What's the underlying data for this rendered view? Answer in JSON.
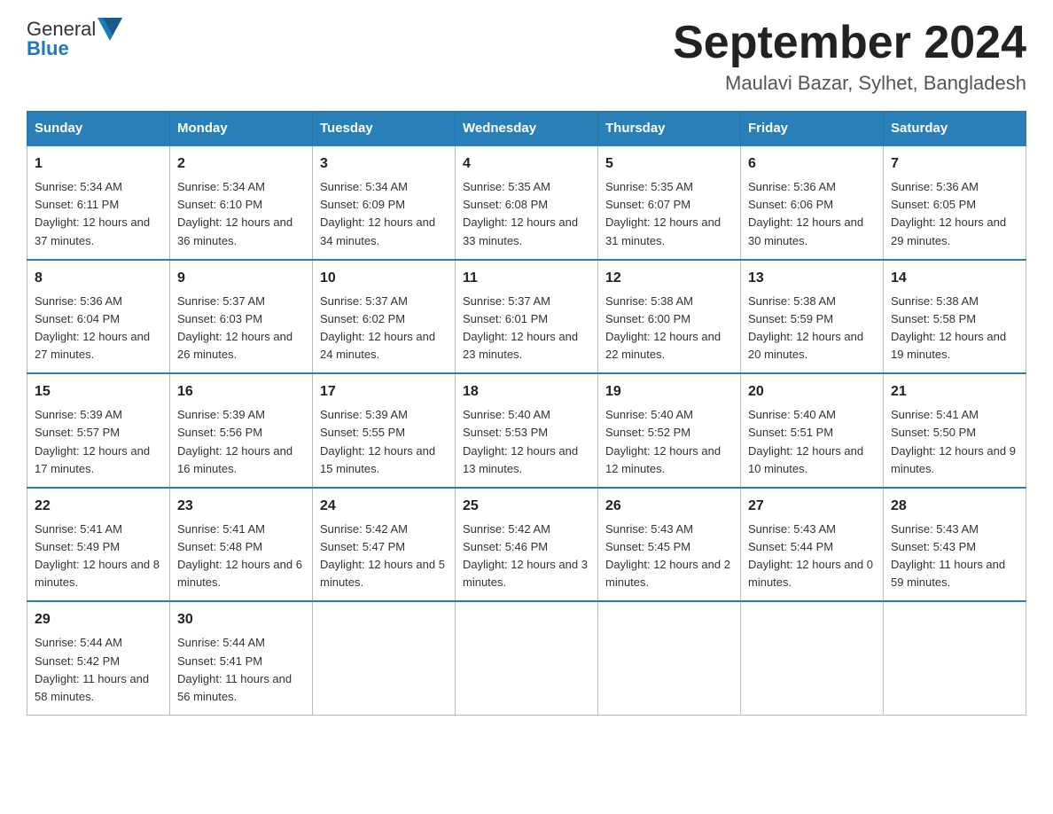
{
  "header": {
    "logo_general": "General",
    "logo_blue": "Blue",
    "month_title": "September 2024",
    "subtitle": "Maulavi Bazar, Sylhet, Bangladesh"
  },
  "days_of_week": [
    "Sunday",
    "Monday",
    "Tuesday",
    "Wednesday",
    "Thursday",
    "Friday",
    "Saturday"
  ],
  "weeks": [
    [
      {
        "day": "1",
        "sunrise": "5:34 AM",
        "sunset": "6:11 PM",
        "daylight": "12 hours and 37 minutes."
      },
      {
        "day": "2",
        "sunrise": "5:34 AM",
        "sunset": "6:10 PM",
        "daylight": "12 hours and 36 minutes."
      },
      {
        "day": "3",
        "sunrise": "5:34 AM",
        "sunset": "6:09 PM",
        "daylight": "12 hours and 34 minutes."
      },
      {
        "day": "4",
        "sunrise": "5:35 AM",
        "sunset": "6:08 PM",
        "daylight": "12 hours and 33 minutes."
      },
      {
        "day": "5",
        "sunrise": "5:35 AM",
        "sunset": "6:07 PM",
        "daylight": "12 hours and 31 minutes."
      },
      {
        "day": "6",
        "sunrise": "5:36 AM",
        "sunset": "6:06 PM",
        "daylight": "12 hours and 30 minutes."
      },
      {
        "day": "7",
        "sunrise": "5:36 AM",
        "sunset": "6:05 PM",
        "daylight": "12 hours and 29 minutes."
      }
    ],
    [
      {
        "day": "8",
        "sunrise": "5:36 AM",
        "sunset": "6:04 PM",
        "daylight": "12 hours and 27 minutes."
      },
      {
        "day": "9",
        "sunrise": "5:37 AM",
        "sunset": "6:03 PM",
        "daylight": "12 hours and 26 minutes."
      },
      {
        "day": "10",
        "sunrise": "5:37 AM",
        "sunset": "6:02 PM",
        "daylight": "12 hours and 24 minutes."
      },
      {
        "day": "11",
        "sunrise": "5:37 AM",
        "sunset": "6:01 PM",
        "daylight": "12 hours and 23 minutes."
      },
      {
        "day": "12",
        "sunrise": "5:38 AM",
        "sunset": "6:00 PM",
        "daylight": "12 hours and 22 minutes."
      },
      {
        "day": "13",
        "sunrise": "5:38 AM",
        "sunset": "5:59 PM",
        "daylight": "12 hours and 20 minutes."
      },
      {
        "day": "14",
        "sunrise": "5:38 AM",
        "sunset": "5:58 PM",
        "daylight": "12 hours and 19 minutes."
      }
    ],
    [
      {
        "day": "15",
        "sunrise": "5:39 AM",
        "sunset": "5:57 PM",
        "daylight": "12 hours and 17 minutes."
      },
      {
        "day": "16",
        "sunrise": "5:39 AM",
        "sunset": "5:56 PM",
        "daylight": "12 hours and 16 minutes."
      },
      {
        "day": "17",
        "sunrise": "5:39 AM",
        "sunset": "5:55 PM",
        "daylight": "12 hours and 15 minutes."
      },
      {
        "day": "18",
        "sunrise": "5:40 AM",
        "sunset": "5:53 PM",
        "daylight": "12 hours and 13 minutes."
      },
      {
        "day": "19",
        "sunrise": "5:40 AM",
        "sunset": "5:52 PM",
        "daylight": "12 hours and 12 minutes."
      },
      {
        "day": "20",
        "sunrise": "5:40 AM",
        "sunset": "5:51 PM",
        "daylight": "12 hours and 10 minutes."
      },
      {
        "day": "21",
        "sunrise": "5:41 AM",
        "sunset": "5:50 PM",
        "daylight": "12 hours and 9 minutes."
      }
    ],
    [
      {
        "day": "22",
        "sunrise": "5:41 AM",
        "sunset": "5:49 PM",
        "daylight": "12 hours and 8 minutes."
      },
      {
        "day": "23",
        "sunrise": "5:41 AM",
        "sunset": "5:48 PM",
        "daylight": "12 hours and 6 minutes."
      },
      {
        "day": "24",
        "sunrise": "5:42 AM",
        "sunset": "5:47 PM",
        "daylight": "12 hours and 5 minutes."
      },
      {
        "day": "25",
        "sunrise": "5:42 AM",
        "sunset": "5:46 PM",
        "daylight": "12 hours and 3 minutes."
      },
      {
        "day": "26",
        "sunrise": "5:43 AM",
        "sunset": "5:45 PM",
        "daylight": "12 hours and 2 minutes."
      },
      {
        "day": "27",
        "sunrise": "5:43 AM",
        "sunset": "5:44 PM",
        "daylight": "12 hours and 0 minutes."
      },
      {
        "day": "28",
        "sunrise": "5:43 AM",
        "sunset": "5:43 PM",
        "daylight": "11 hours and 59 minutes."
      }
    ],
    [
      {
        "day": "29",
        "sunrise": "5:44 AM",
        "sunset": "5:42 PM",
        "daylight": "11 hours and 58 minutes."
      },
      {
        "day": "30",
        "sunrise": "5:44 AM",
        "sunset": "5:41 PM",
        "daylight": "11 hours and 56 minutes."
      },
      null,
      null,
      null,
      null,
      null
    ]
  ]
}
